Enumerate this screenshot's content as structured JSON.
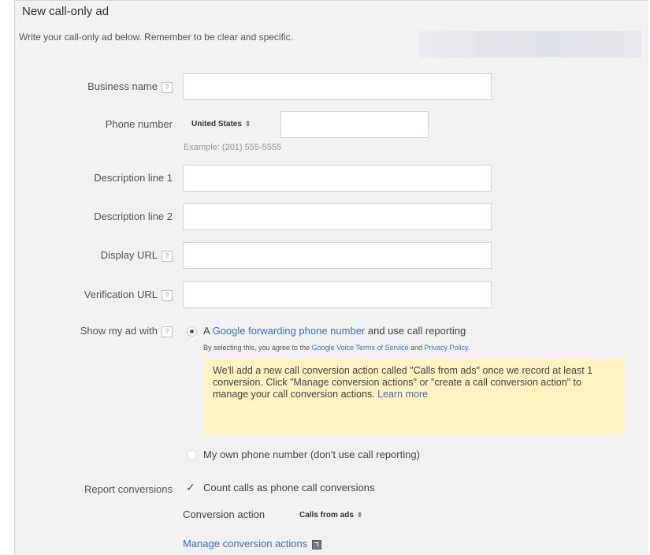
{
  "header": {
    "title": "New call-only ad",
    "subtitle": "Write your call-only ad below. Remember to be clear and specific."
  },
  "fields": {
    "business_name": {
      "label": "Business name",
      "value": ""
    },
    "phone_number": {
      "label": "Phone number",
      "country": "United States",
      "value": "",
      "example": "Example: (201) 555-5555"
    },
    "description_line_1": {
      "label": "Description line 1",
      "value": ""
    },
    "description_line_2": {
      "label": "Description line 2",
      "value": ""
    },
    "display_url": {
      "label": "Display URL",
      "value": ""
    },
    "verification_url": {
      "label": "Verification URL",
      "value": ""
    }
  },
  "show_ad_with": {
    "label": "Show my ad with",
    "option_forwarding": {
      "prefix": "A ",
      "link": "Google forwarding phone number",
      "suffix": " and use call reporting",
      "selected": true
    },
    "agreement": {
      "prefix": "By selecting this, you agree to the ",
      "tos_link": "Google Voice Terms of Service",
      "and": " and ",
      "privacy_link": "Privacy Policy",
      "end": "."
    },
    "notice": {
      "text": "We'll add a new call conversion action called \"Calls from ads\" once we record at least 1 conversion. Click \"Manage conversion actions\" or \"create a call conversion action\" to manage your call conversion actions.",
      "learn_more": "Learn more"
    },
    "option_own": {
      "text": "My own phone number (don't use call reporting)",
      "selected": false
    }
  },
  "report_conversions": {
    "label": "Report conversions",
    "checkbox_label": "Count calls as phone call conversions",
    "checked": true,
    "conversion_action_label": "Conversion action",
    "conversion_action_value": "Calls from ads",
    "manage_link": "Manage conversion actions"
  },
  "help_glyph": "?",
  "select_arrow": "⬍",
  "checkmark": "✓"
}
